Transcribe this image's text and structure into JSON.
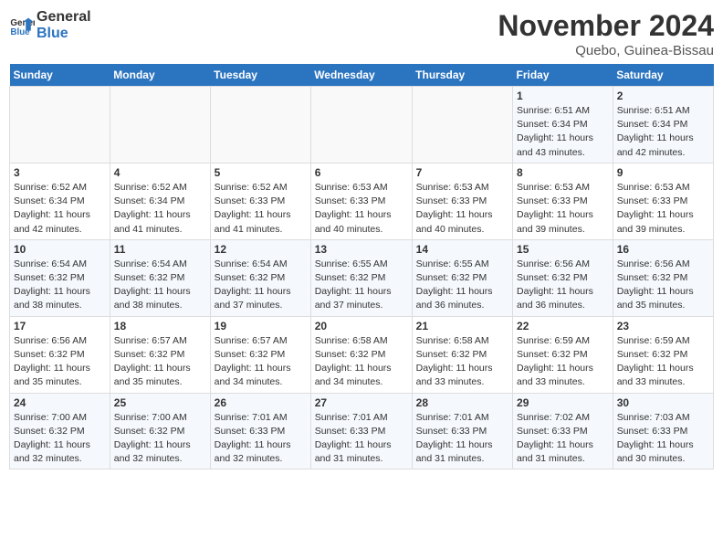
{
  "header": {
    "logo_line1": "General",
    "logo_line2": "Blue",
    "month_title": "November 2024",
    "location": "Quebo, Guinea-Bissau"
  },
  "days_of_week": [
    "Sunday",
    "Monday",
    "Tuesday",
    "Wednesday",
    "Thursday",
    "Friday",
    "Saturday"
  ],
  "weeks": [
    [
      {
        "day": "",
        "detail": ""
      },
      {
        "day": "",
        "detail": ""
      },
      {
        "day": "",
        "detail": ""
      },
      {
        "day": "",
        "detail": ""
      },
      {
        "day": "",
        "detail": ""
      },
      {
        "day": "1",
        "detail": "Sunrise: 6:51 AM\nSunset: 6:34 PM\nDaylight: 11 hours and 43 minutes."
      },
      {
        "day": "2",
        "detail": "Sunrise: 6:51 AM\nSunset: 6:34 PM\nDaylight: 11 hours and 42 minutes."
      }
    ],
    [
      {
        "day": "3",
        "detail": "Sunrise: 6:52 AM\nSunset: 6:34 PM\nDaylight: 11 hours and 42 minutes."
      },
      {
        "day": "4",
        "detail": "Sunrise: 6:52 AM\nSunset: 6:34 PM\nDaylight: 11 hours and 41 minutes."
      },
      {
        "day": "5",
        "detail": "Sunrise: 6:52 AM\nSunset: 6:33 PM\nDaylight: 11 hours and 41 minutes."
      },
      {
        "day": "6",
        "detail": "Sunrise: 6:53 AM\nSunset: 6:33 PM\nDaylight: 11 hours and 40 minutes."
      },
      {
        "day": "7",
        "detail": "Sunrise: 6:53 AM\nSunset: 6:33 PM\nDaylight: 11 hours and 40 minutes."
      },
      {
        "day": "8",
        "detail": "Sunrise: 6:53 AM\nSunset: 6:33 PM\nDaylight: 11 hours and 39 minutes."
      },
      {
        "day": "9",
        "detail": "Sunrise: 6:53 AM\nSunset: 6:33 PM\nDaylight: 11 hours and 39 minutes."
      }
    ],
    [
      {
        "day": "10",
        "detail": "Sunrise: 6:54 AM\nSunset: 6:32 PM\nDaylight: 11 hours and 38 minutes."
      },
      {
        "day": "11",
        "detail": "Sunrise: 6:54 AM\nSunset: 6:32 PM\nDaylight: 11 hours and 38 minutes."
      },
      {
        "day": "12",
        "detail": "Sunrise: 6:54 AM\nSunset: 6:32 PM\nDaylight: 11 hours and 37 minutes."
      },
      {
        "day": "13",
        "detail": "Sunrise: 6:55 AM\nSunset: 6:32 PM\nDaylight: 11 hours and 37 minutes."
      },
      {
        "day": "14",
        "detail": "Sunrise: 6:55 AM\nSunset: 6:32 PM\nDaylight: 11 hours and 36 minutes."
      },
      {
        "day": "15",
        "detail": "Sunrise: 6:56 AM\nSunset: 6:32 PM\nDaylight: 11 hours and 36 minutes."
      },
      {
        "day": "16",
        "detail": "Sunrise: 6:56 AM\nSunset: 6:32 PM\nDaylight: 11 hours and 35 minutes."
      }
    ],
    [
      {
        "day": "17",
        "detail": "Sunrise: 6:56 AM\nSunset: 6:32 PM\nDaylight: 11 hours and 35 minutes."
      },
      {
        "day": "18",
        "detail": "Sunrise: 6:57 AM\nSunset: 6:32 PM\nDaylight: 11 hours and 35 minutes."
      },
      {
        "day": "19",
        "detail": "Sunrise: 6:57 AM\nSunset: 6:32 PM\nDaylight: 11 hours and 34 minutes."
      },
      {
        "day": "20",
        "detail": "Sunrise: 6:58 AM\nSunset: 6:32 PM\nDaylight: 11 hours and 34 minutes."
      },
      {
        "day": "21",
        "detail": "Sunrise: 6:58 AM\nSunset: 6:32 PM\nDaylight: 11 hours and 33 minutes."
      },
      {
        "day": "22",
        "detail": "Sunrise: 6:59 AM\nSunset: 6:32 PM\nDaylight: 11 hours and 33 minutes."
      },
      {
        "day": "23",
        "detail": "Sunrise: 6:59 AM\nSunset: 6:32 PM\nDaylight: 11 hours and 33 minutes."
      }
    ],
    [
      {
        "day": "24",
        "detail": "Sunrise: 7:00 AM\nSunset: 6:32 PM\nDaylight: 11 hours and 32 minutes."
      },
      {
        "day": "25",
        "detail": "Sunrise: 7:00 AM\nSunset: 6:32 PM\nDaylight: 11 hours and 32 minutes."
      },
      {
        "day": "26",
        "detail": "Sunrise: 7:01 AM\nSunset: 6:33 PM\nDaylight: 11 hours and 32 minutes."
      },
      {
        "day": "27",
        "detail": "Sunrise: 7:01 AM\nSunset: 6:33 PM\nDaylight: 11 hours and 31 minutes."
      },
      {
        "day": "28",
        "detail": "Sunrise: 7:01 AM\nSunset: 6:33 PM\nDaylight: 11 hours and 31 minutes."
      },
      {
        "day": "29",
        "detail": "Sunrise: 7:02 AM\nSunset: 6:33 PM\nDaylight: 11 hours and 31 minutes."
      },
      {
        "day": "30",
        "detail": "Sunrise: 7:03 AM\nSunset: 6:33 PM\nDaylight: 11 hours and 30 minutes."
      }
    ]
  ]
}
